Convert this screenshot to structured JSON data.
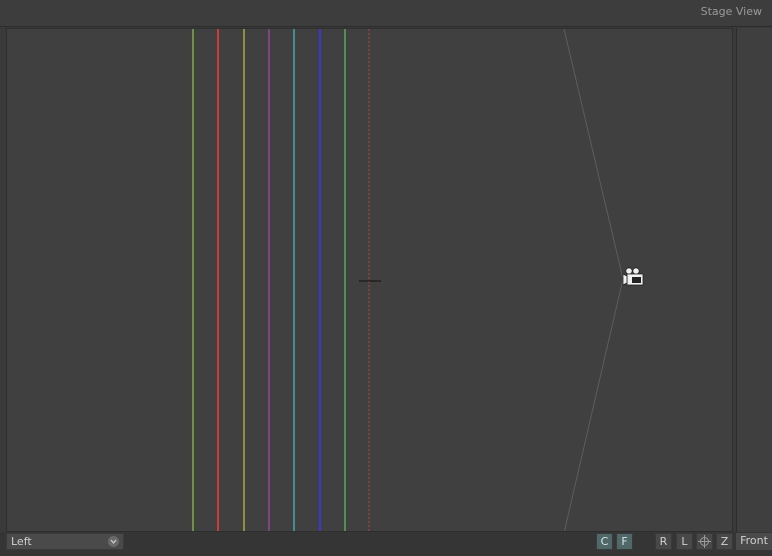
{
  "window": {
    "title": "Stage View"
  },
  "viewport": {
    "guides": [
      {
        "color": "#9be34a",
        "style": "solid"
      },
      {
        "color": "#cc3a3a",
        "style": "solid"
      },
      {
        "color": "#e0e04a",
        "style": "solid"
      },
      {
        "color": "#c04ac0",
        "style": "solid"
      },
      {
        "color": "#4ad8d8",
        "style": "solid"
      },
      {
        "color": "#3a3ad0",
        "style": "solid"
      },
      {
        "color": "#6ad86a",
        "style": "solid"
      },
      {
        "color": "#c04040",
        "style": "dashed"
      }
    ],
    "camera_icon": "camera-icon",
    "crosshair_icon": "crosshair-icon"
  },
  "bottombar": {
    "view_select": "Left",
    "toggle_c": "C",
    "toggle_f": "F",
    "btn_r": "R",
    "btn_l": "L",
    "btn_z": "Z",
    "front_label": "Front"
  },
  "colors": {
    "background": "#404040",
    "toggle_active": "#506868",
    "frustum": "#5c5c5c"
  }
}
